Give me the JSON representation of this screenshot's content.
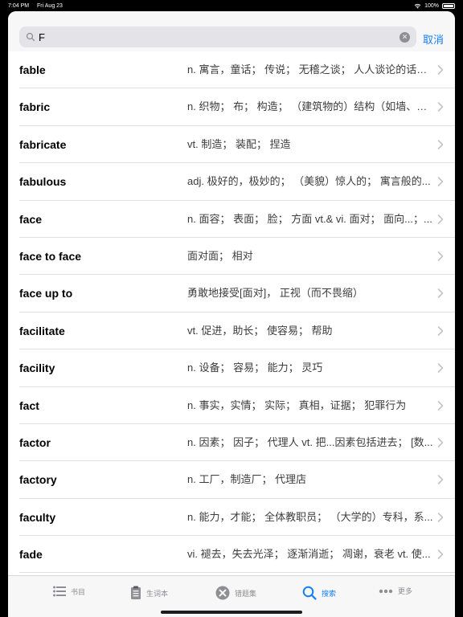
{
  "status": {
    "time": "7:04 PM",
    "date": "Fri Aug 23",
    "battery": "100%",
    "battery_level": 1.0
  },
  "search": {
    "value": "F",
    "placeholder": "",
    "cancel_label": "取消"
  },
  "words": [
    {
      "word": "fable",
      "meaning": "n. 寓言，童话； 传说； 无稽之谈； 人人谈论的话题..."
    },
    {
      "word": "fabric",
      "meaning": "n. 织物； 布； 构造； （建筑物的）结构（如墙、地..."
    },
    {
      "word": "fabricate",
      "meaning": "vt. 制造； 装配； 捏造"
    },
    {
      "word": "fabulous",
      "meaning": "adj. 极好的，极妙的； （美貌）惊人的； 寓言般的..."
    },
    {
      "word": "face",
      "meaning": "n. 面容； 表面； 脸； 方面 vt.& vi. 面对； 面向...；..."
    },
    {
      "word": "face to face",
      "meaning": "面对面； 相对"
    },
    {
      "word": "face up to",
      "meaning": "勇敢地接受[面对]， 正视（而不畏缩）"
    },
    {
      "word": "facilitate",
      "meaning": "vt. 促进，助长； 使容易； 帮助"
    },
    {
      "word": "facility",
      "meaning": "n. 设备； 容易； 能力； 灵巧"
    },
    {
      "word": "fact",
      "meaning": "n. 事实，实情； 实际； 真相，证据； 犯罪行为"
    },
    {
      "word": "factor",
      "meaning": "n. 因素； 因子； 代理人 vt. 把...因素包括进去； [数..."
    },
    {
      "word": "factory",
      "meaning": "n. 工厂，制造厂； 代理店"
    },
    {
      "word": "faculty",
      "meaning": "n. 能力，才能； 全体教职员； （大学的）专科，系..."
    },
    {
      "word": "fade",
      "meaning": "vi. 褪去，失去光泽； 逐渐消逝； 凋谢，衰老 vt. 使..."
    }
  ],
  "tabs": [
    {
      "label": "书目",
      "icon": "list-icon"
    },
    {
      "label": "生词本",
      "icon": "clipboard-icon"
    },
    {
      "label": "错题集",
      "icon": "x-circle-icon"
    },
    {
      "label": "搜索",
      "icon": "search-icon"
    },
    {
      "label": "更多",
      "icon": "ellipsis-icon"
    }
  ],
  "colors": {
    "accent": "#147efb",
    "inactive": "#8e8e93"
  }
}
